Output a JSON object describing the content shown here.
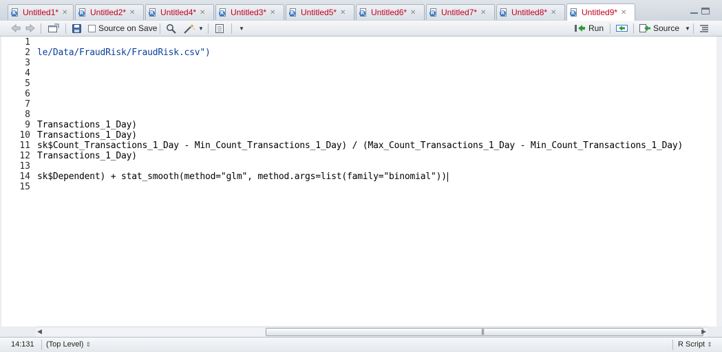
{
  "tabs": [
    {
      "label": "Untitled1*"
    },
    {
      "label": "Untitled2*"
    },
    {
      "label": "Untitled4*"
    },
    {
      "label": "Untitled3*"
    },
    {
      "label": "Untitled5*"
    },
    {
      "label": "Untitled6*"
    },
    {
      "label": "Untitled7*"
    },
    {
      "label": "Untitled8*"
    },
    {
      "label": "Untitled9*"
    }
  ],
  "active_tab": "Untitled9*",
  "toolbar": {
    "source_on_save_label": "Source on Save",
    "run_label": "Run",
    "source_label": "Source"
  },
  "editor": {
    "line_numbers": [
      "1",
      "2",
      "3",
      "4",
      "5",
      "6",
      "7",
      "8",
      "9",
      "10",
      "11",
      "12",
      "13",
      "14",
      "15"
    ],
    "lines": [
      "",
      "le/Data/FraudRisk/FraudRisk.csv\")",
      "",
      "",
      "",
      "",
      "",
      "",
      "Transactions_1_Day)",
      "Transactions_1_Day)",
      "sk$Count_Transactions_1_Day - Min_Count_Transactions_1_Day) / (Max_Count_Transactions_1_Day - Min_Count_Transactions_1_Day)",
      "Transactions_1_Day)",
      "",
      "sk$Dependent) + stat_smooth(method=\"glm\", method.args=list(family=\"binomial\"))",
      ""
    ]
  },
  "status": {
    "position": "14:131",
    "scope": "(Top Level)",
    "file_type": "R Script"
  },
  "colors": {
    "tab_text": "#c0001a",
    "string": "#0a3f9c",
    "run_arrow": "#2e9b3a"
  }
}
